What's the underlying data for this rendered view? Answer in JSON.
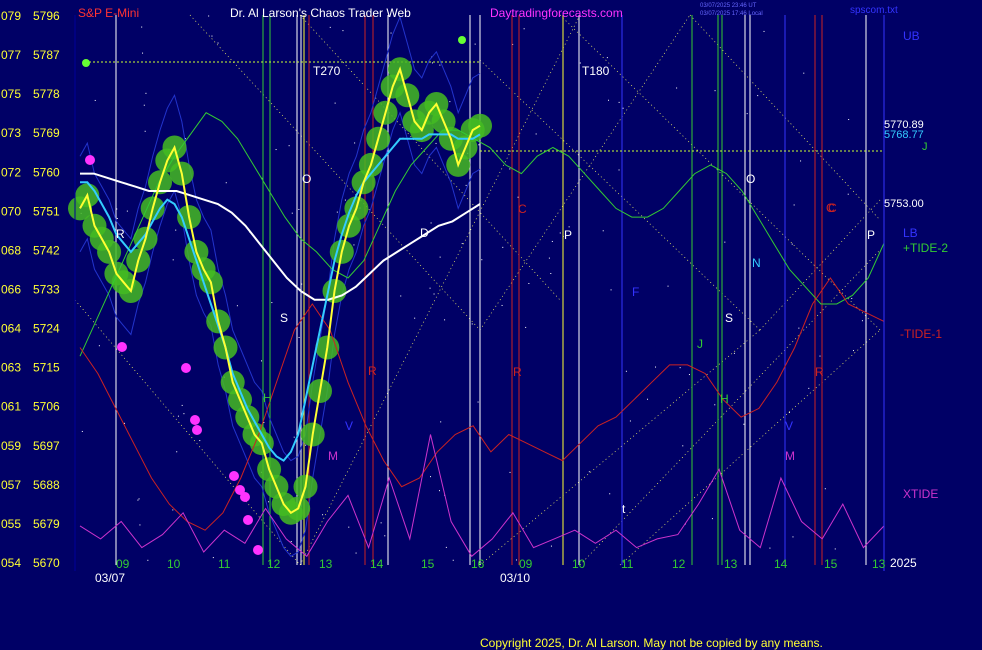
{
  "header": {
    "symbol": "S&P E-Mini",
    "title": "Dr. Al Larson's Chaos Trader Web",
    "site": "Daytradingforecasts.com",
    "stamp1": "03/07/2025 23:46 UT",
    "stamp2": "03/07/2025 17:46 Local",
    "file": "spscom.txt"
  },
  "footer": {
    "copyright": "Copyright 2025, Dr. Al Larson. May not be copied by any means.",
    "year": "2025"
  },
  "chart_data": {
    "type": "line",
    "y_axis": {
      "left_codes": [
        "079",
        "077",
        "075",
        "073",
        "072",
        "070",
        "068",
        "066",
        "064",
        "063",
        "061",
        "059",
        "057",
        "055",
        "054"
      ],
      "left_prices": [
        "5796",
        "5787",
        "5778",
        "5769",
        "5760",
        "5751",
        "5742",
        "5733",
        "5724",
        "5715",
        "5706",
        "5697",
        "5688",
        "5679",
        "5670"
      ],
      "ylim": [
        5670,
        5796
      ]
    },
    "x_axis": {
      "hour_labels": [
        "09",
        "10",
        "11",
        "12",
        "13",
        "14",
        "15",
        "16",
        "09",
        "10",
        "11",
        "12",
        "13",
        "14",
        "15",
        "13"
      ],
      "date_labels": [
        "03/07",
        "03/10"
      ]
    },
    "right_labels": {
      "ub": "UB",
      "lb": "LB",
      "price_yellow": "5770.89",
      "price_cyan": "5768.77",
      "j": "J",
      "price_white": "5753.00",
      "tide2": "+TIDE-2",
      "tide1": "-TIDE-1",
      "xtide": "XTIDE"
    },
    "annotations": {
      "t270": "T270",
      "t180": "T180",
      "letters": [
        "R",
        "S",
        "H",
        "O",
        "M",
        "V",
        "R",
        "C",
        "P",
        "C",
        "R",
        "J",
        "S",
        "N",
        "O",
        "H",
        "V",
        "M",
        "R",
        "C",
        "P",
        "t",
        "D",
        "F"
      ]
    },
    "series": [
      {
        "id": "price-path",
        "color": "#ffff33",
        "values": [
          5752,
          5755,
          5748,
          5745,
          5742,
          5737,
          5735,
          5733,
          5740,
          5745,
          5752,
          5758,
          5763,
          5766,
          5760,
          5750,
          5742,
          5738,
          5735,
          5726,
          5720,
          5712,
          5708,
          5704,
          5700,
          5698,
          5692,
          5688,
          5684,
          5682,
          5683,
          5688,
          5700,
          5710,
          5720,
          5733,
          5742,
          5748,
          5752,
          5758,
          5762,
          5768,
          5774,
          5780,
          5784,
          5778,
          5772,
          5770,
          5774,
          5776,
          5772,
          5768,
          5762,
          5766,
          5770,
          5771
        ]
      },
      {
        "id": "cyan-average",
        "color": "#33ccff",
        "values": [
          5758,
          5758,
          5756,
          5753,
          5750,
          5746,
          5744,
          5742,
          5744,
          5746,
          5749,
          5752,
          5754,
          5753,
          5750,
          5745,
          5740,
          5735,
          5730,
          5725,
          5720,
          5714,
          5710,
          5706,
          5703,
          5700,
          5697,
          5695,
          5694,
          5696,
          5700,
          5708,
          5716,
          5724,
          5732,
          5740,
          5746,
          5751,
          5755,
          5758,
          5760,
          5762,
          5764,
          5766,
          5768,
          5768,
          5768,
          5768,
          5769,
          5769,
          5769,
          5769,
          5768,
          5768,
          5768,
          5769
        ]
      },
      {
        "id": "white-average",
        "color": "#ffffff",
        "values": [
          5760,
          5760,
          5759,
          5758,
          5757,
          5756,
          5756,
          5756,
          5755,
          5754,
          5753,
          5751,
          5748,
          5744,
          5740,
          5736,
          5733,
          5731,
          5731,
          5732,
          5734,
          5737,
          5740,
          5742,
          5744,
          5746,
          5748,
          5749,
          5751,
          5753
        ]
      },
      {
        "id": "green-forecast",
        "color": "#33cc33",
        "values": [
          5718,
          5726,
          5734,
          5742,
          5750,
          5758,
          5764,
          5769,
          5774,
          5772,
          5768,
          5762,
          5756,
          5750,
          5745,
          5742,
          5738,
          5736,
          5740,
          5748,
          5756,
          5762,
          5766,
          5770,
          5770,
          5768,
          5766,
          5762,
          5760,
          5764,
          5766,
          5764,
          5760,
          5756,
          5752,
          5750,
          5750,
          5752,
          5756,
          5760,
          5762,
          5760,
          5756,
          5750,
          5744,
          5738,
          5734,
          5730,
          5730,
          5732,
          5736,
          5744
        ]
      },
      {
        "id": "red-tide",
        "color": "#cc2222",
        "values": [
          5720,
          5714,
          5706,
          5698,
          5690,
          5684,
          5680,
          5678,
          5682,
          5690,
          5700,
          5712,
          5724,
          5730,
          5724,
          5712,
          5702,
          5694,
          5688,
          5690,
          5696,
          5700,
          5702,
          5696,
          5700,
          5698,
          5696,
          5694,
          5698,
          5702,
          5704,
          5708,
          5712,
          5716,
          5716,
          5714,
          5708,
          5704,
          5706,
          5712,
          5720,
          5730,
          5736,
          5730,
          5728,
          5726
        ]
      },
      {
        "id": "xtide",
        "color": "#cc33cc",
        "values": [
          5679,
          5676,
          5680,
          5674,
          5677,
          5682,
          5673,
          5678,
          5675,
          5683,
          5676,
          5672,
          5680,
          5686,
          5674,
          5690,
          5676,
          5700,
          5680,
          5672,
          5676,
          5682,
          5674,
          5676,
          5678,
          5675,
          5678,
          5674,
          5676,
          5677,
          5684,
          5692,
          5678,
          5674,
          5690,
          5680,
          5676,
          5684,
          5674,
          5679
        ]
      }
    ]
  }
}
